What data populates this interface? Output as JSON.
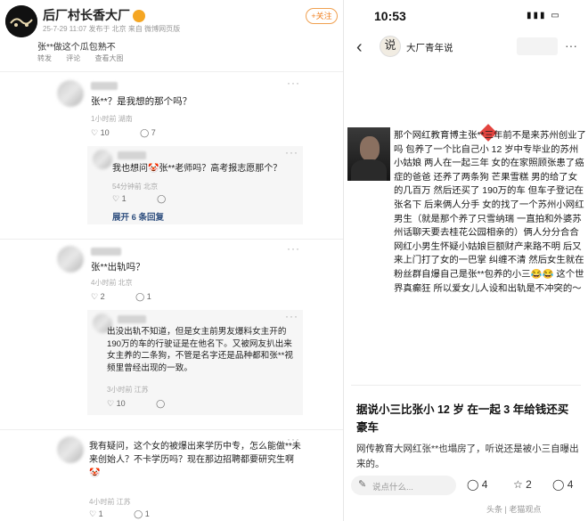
{
  "left": {
    "account": {
      "name": "后厂村长香大厂",
      "meta": "25-7-29 11:07 发布于 北京 来自 微博网页版",
      "follow_label": "+关注",
      "post_text": "张**做这个瓜包熟不"
    },
    "post_tools": [
      "转发",
      "评论",
      "查看大图"
    ],
    "comments": [
      {
        "text": "张**？是我想的那个吗？",
        "meta": "1小时前 湖南",
        "likes": "10",
        "replies": "7",
        "reply": {
          "text": "我也想问🤡张**老师吗？高考报志愿那个？",
          "meta": "54分钟前 北京",
          "likes": "1"
        },
        "expand_label": "展开 6 条回复"
      },
      {
        "text": "张**出轨吗？",
        "meta": "4小时前 北京",
        "likes": "2",
        "replies": "1",
        "reply": {
          "text": "出没出轨不知道，但是女主前男友爆料女主开的190万的车的行驶证是在他名下。又被网友扒出来女主养的二条狗，不管是名字还是品种都和张**视频里曾经出现的一致。",
          "meta": "3小时前 江苏",
          "likes": "10"
        }
      },
      {
        "text": "我有疑问，这个女的被爆出来学历中专，怎么能做**未来创始人？不卡学历吗？现在那边招聘都要研究生啊🤡",
        "meta": "4小时前 江苏",
        "likes": "1",
        "replies": "1"
      }
    ]
  },
  "right": {
    "time": "10:53",
    "account_name": "大厂青年说",
    "account_avatar": "说",
    "story": "那个网红教育博主张**三年前不是来苏州创业了吗 包养了一个比自己小 12 岁中专毕业的苏州小姑娘 两人在一起三年 女的在家照顾张患了癌症的爸爸 还养了两条狗 芒果雪糕 男的给了女的几百万 然后还买了 190万的车 但车子登记在张名下 后来俩人分手 女的找了一个苏州小网红男生（就是那个养了只雪纳瑞 一直拍和外婆苏州话聊天要去桂花公园相亲的）俩人分分合合 网红小男生怀疑小姑娘巨额财产来路不明 后又来上门打了女的一巴掌 纠缠不清 然后女生就在粉丝群自爆自己是张**包养的小三😂😂 这个世界真癫狂 所以爱女儿人设和出轨是不冲突的～",
    "headline": "据说小三比张小 12 岁 在一起 3 年给钱还买豪车",
    "sub": "网传教育大网红张**也塌房了，听说还是被小三自曝出来的。",
    "composer_placeholder": "说点什么...",
    "actions": [
      "4",
      "2",
      "4"
    ],
    "footer": "头条 | 老猫观点"
  },
  "colors": {
    "accent": "#f08020",
    "link": "#2f4f7f",
    "red": "#e0302a"
  }
}
